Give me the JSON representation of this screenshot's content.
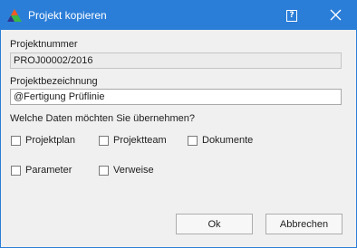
{
  "window": {
    "title": "Projekt kopieren"
  },
  "titlebar": {
    "help_label": "?"
  },
  "fields": {
    "projektnummer": {
      "label": "Projektnummer",
      "value": "PROJ00002/2016"
    },
    "projektbezeichnung": {
      "label": "Projektbezeichnung",
      "value": "@Fertigung Prüflinie"
    }
  },
  "question": "Welche Daten möchten Sie übernehmen?",
  "options": [
    {
      "label": "Projektplan",
      "checked": false
    },
    {
      "label": "Projektteam",
      "checked": false
    },
    {
      "label": "Dokumente",
      "checked": false
    },
    {
      "label": "Parameter",
      "checked": false
    },
    {
      "label": "Verweise",
      "checked": false
    }
  ],
  "buttons": {
    "ok": "Ok",
    "cancel": "Abbrechen"
  },
  "colors": {
    "titlebar": "#2b7ed8",
    "dialog_bg": "#f0f0f0"
  }
}
